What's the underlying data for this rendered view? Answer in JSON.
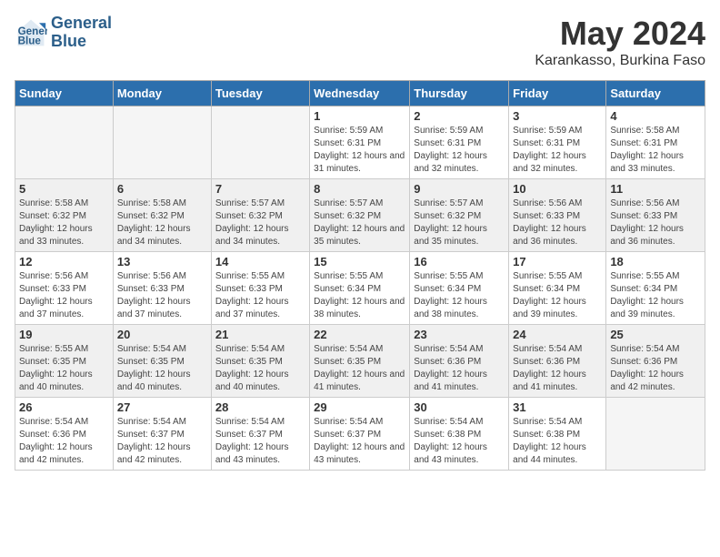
{
  "header": {
    "logo_line1": "General",
    "logo_line2": "Blue",
    "month_title": "May 2024",
    "location": "Karankasso, Burkina Faso"
  },
  "days_of_week": [
    "Sunday",
    "Monday",
    "Tuesday",
    "Wednesday",
    "Thursday",
    "Friday",
    "Saturday"
  ],
  "weeks": [
    [
      {
        "day": "",
        "empty": true
      },
      {
        "day": "",
        "empty": true
      },
      {
        "day": "",
        "empty": true
      },
      {
        "day": "1",
        "sunrise": "Sunrise: 5:59 AM",
        "sunset": "Sunset: 6:31 PM",
        "daylight": "Daylight: 12 hours and 31 minutes."
      },
      {
        "day": "2",
        "sunrise": "Sunrise: 5:59 AM",
        "sunset": "Sunset: 6:31 PM",
        "daylight": "Daylight: 12 hours and 32 minutes."
      },
      {
        "day": "3",
        "sunrise": "Sunrise: 5:59 AM",
        "sunset": "Sunset: 6:31 PM",
        "daylight": "Daylight: 12 hours and 32 minutes."
      },
      {
        "day": "4",
        "sunrise": "Sunrise: 5:58 AM",
        "sunset": "Sunset: 6:31 PM",
        "daylight": "Daylight: 12 hours and 33 minutes."
      }
    ],
    [
      {
        "day": "5",
        "sunrise": "Sunrise: 5:58 AM",
        "sunset": "Sunset: 6:32 PM",
        "daylight": "Daylight: 12 hours and 33 minutes."
      },
      {
        "day": "6",
        "sunrise": "Sunrise: 5:58 AM",
        "sunset": "Sunset: 6:32 PM",
        "daylight": "Daylight: 12 hours and 34 minutes."
      },
      {
        "day": "7",
        "sunrise": "Sunrise: 5:57 AM",
        "sunset": "Sunset: 6:32 PM",
        "daylight": "Daylight: 12 hours and 34 minutes."
      },
      {
        "day": "8",
        "sunrise": "Sunrise: 5:57 AM",
        "sunset": "Sunset: 6:32 PM",
        "daylight": "Daylight: 12 hours and 35 minutes."
      },
      {
        "day": "9",
        "sunrise": "Sunrise: 5:57 AM",
        "sunset": "Sunset: 6:32 PM",
        "daylight": "Daylight: 12 hours and 35 minutes."
      },
      {
        "day": "10",
        "sunrise": "Sunrise: 5:56 AM",
        "sunset": "Sunset: 6:33 PM",
        "daylight": "Daylight: 12 hours and 36 minutes."
      },
      {
        "day": "11",
        "sunrise": "Sunrise: 5:56 AM",
        "sunset": "Sunset: 6:33 PM",
        "daylight": "Daylight: 12 hours and 36 minutes."
      }
    ],
    [
      {
        "day": "12",
        "sunrise": "Sunrise: 5:56 AM",
        "sunset": "Sunset: 6:33 PM",
        "daylight": "Daylight: 12 hours and 37 minutes."
      },
      {
        "day": "13",
        "sunrise": "Sunrise: 5:56 AM",
        "sunset": "Sunset: 6:33 PM",
        "daylight": "Daylight: 12 hours and 37 minutes."
      },
      {
        "day": "14",
        "sunrise": "Sunrise: 5:55 AM",
        "sunset": "Sunset: 6:33 PM",
        "daylight": "Daylight: 12 hours and 37 minutes."
      },
      {
        "day": "15",
        "sunrise": "Sunrise: 5:55 AM",
        "sunset": "Sunset: 6:34 PM",
        "daylight": "Daylight: 12 hours and 38 minutes."
      },
      {
        "day": "16",
        "sunrise": "Sunrise: 5:55 AM",
        "sunset": "Sunset: 6:34 PM",
        "daylight": "Daylight: 12 hours and 38 minutes."
      },
      {
        "day": "17",
        "sunrise": "Sunrise: 5:55 AM",
        "sunset": "Sunset: 6:34 PM",
        "daylight": "Daylight: 12 hours and 39 minutes."
      },
      {
        "day": "18",
        "sunrise": "Sunrise: 5:55 AM",
        "sunset": "Sunset: 6:34 PM",
        "daylight": "Daylight: 12 hours and 39 minutes."
      }
    ],
    [
      {
        "day": "19",
        "sunrise": "Sunrise: 5:55 AM",
        "sunset": "Sunset: 6:35 PM",
        "daylight": "Daylight: 12 hours and 40 minutes."
      },
      {
        "day": "20",
        "sunrise": "Sunrise: 5:54 AM",
        "sunset": "Sunset: 6:35 PM",
        "daylight": "Daylight: 12 hours and 40 minutes."
      },
      {
        "day": "21",
        "sunrise": "Sunrise: 5:54 AM",
        "sunset": "Sunset: 6:35 PM",
        "daylight": "Daylight: 12 hours and 40 minutes."
      },
      {
        "day": "22",
        "sunrise": "Sunrise: 5:54 AM",
        "sunset": "Sunset: 6:35 PM",
        "daylight": "Daylight: 12 hours and 41 minutes."
      },
      {
        "day": "23",
        "sunrise": "Sunrise: 5:54 AM",
        "sunset": "Sunset: 6:36 PM",
        "daylight": "Daylight: 12 hours and 41 minutes."
      },
      {
        "day": "24",
        "sunrise": "Sunrise: 5:54 AM",
        "sunset": "Sunset: 6:36 PM",
        "daylight": "Daylight: 12 hours and 41 minutes."
      },
      {
        "day": "25",
        "sunrise": "Sunrise: 5:54 AM",
        "sunset": "Sunset: 6:36 PM",
        "daylight": "Daylight: 12 hours and 42 minutes."
      }
    ],
    [
      {
        "day": "26",
        "sunrise": "Sunrise: 5:54 AM",
        "sunset": "Sunset: 6:36 PM",
        "daylight": "Daylight: 12 hours and 42 minutes."
      },
      {
        "day": "27",
        "sunrise": "Sunrise: 5:54 AM",
        "sunset": "Sunset: 6:37 PM",
        "daylight": "Daylight: 12 hours and 42 minutes."
      },
      {
        "day": "28",
        "sunrise": "Sunrise: 5:54 AM",
        "sunset": "Sunset: 6:37 PM",
        "daylight": "Daylight: 12 hours and 43 minutes."
      },
      {
        "day": "29",
        "sunrise": "Sunrise: 5:54 AM",
        "sunset": "Sunset: 6:37 PM",
        "daylight": "Daylight: 12 hours and 43 minutes."
      },
      {
        "day": "30",
        "sunrise": "Sunrise: 5:54 AM",
        "sunset": "Sunset: 6:38 PM",
        "daylight": "Daylight: 12 hours and 43 minutes."
      },
      {
        "day": "31",
        "sunrise": "Sunrise: 5:54 AM",
        "sunset": "Sunset: 6:38 PM",
        "daylight": "Daylight: 12 hours and 44 minutes."
      },
      {
        "day": "",
        "empty": true
      }
    ]
  ]
}
